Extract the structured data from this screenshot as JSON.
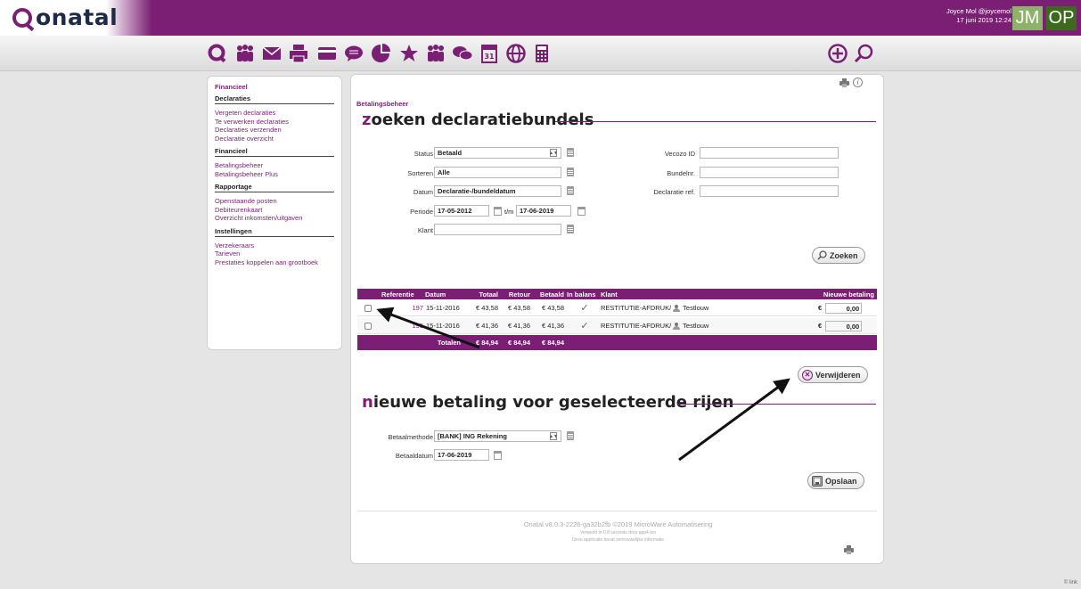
{
  "brand": {
    "name": "onatal"
  },
  "user": {
    "name": "Joyce Mol @joycemol",
    "datetime": "17 juni 2019 12:24",
    "avatar1": "JM",
    "avatar2": "OP"
  },
  "nav_icons": [
    "home-q-icon",
    "users-icon",
    "mail-icon",
    "printer-icon",
    "card-icon",
    "chat-bubble-icon",
    "pie-chart-icon",
    "star-icon",
    "group-icon",
    "comments-icon",
    "calendar-31-icon",
    "globe-icon",
    "calculator-icon",
    "add-circle-icon",
    "search-icon"
  ],
  "sidebar": {
    "title": "Financieel",
    "groups": [
      {
        "heading": "Declaraties",
        "links": [
          "Vergeten declaraties",
          "Te verwerken declaraties",
          "Declaraties verzenden",
          "Declaratie overzicht"
        ]
      },
      {
        "heading": "Financieel",
        "links": [
          "Betalingsbeheer",
          "Betalingsbeheer Plus"
        ]
      },
      {
        "heading": "Rapportage",
        "links": [
          "Openstaande posten",
          "Debiteurenkaart",
          "Overzicht inkomsten/uitgaven"
        ]
      },
      {
        "heading": "Instellingen",
        "links": [
          "Verzekeraars",
          "Tarieven",
          "Prestaties koppelen aan grootboek"
        ]
      }
    ]
  },
  "main": {
    "breadcrumb": "Betalingsbeheer",
    "search_title_first": "z",
    "search_title_rest": "oeken declaratiebundels",
    "form": {
      "status_label": "Status",
      "status_value": "Betaald",
      "sorteren_label": "Sorteren",
      "sorteren_value": "Alle",
      "datum_label": "Datum",
      "datum_value": "Declaratie-/bundeldatum",
      "periode_label": "Periode",
      "periode_from": "17-05-2012",
      "periode_sep": "t/m",
      "periode_to": "17-06-2019",
      "klant_label": "Klant",
      "klant_value": "",
      "vecozo_label": "Vecozo ID",
      "vecozo_value": "",
      "bundelnr_label": "Bundelnr.",
      "bundelnr_value": "",
      "declref_label": "Declaratie ref.",
      "declref_value": ""
    },
    "search_button": "Zoeken",
    "table": {
      "headers": {
        "ref": "Referentie",
        "datum": "Datum",
        "totaal": "Totaal",
        "retour": "Retour",
        "betaald": "Betaald",
        "balans": "In balans",
        "klant": "Klant",
        "nieuwe": "Nieuwe betaling"
      },
      "rows": [
        {
          "ref": "197",
          "datum": "15-11-2016",
          "totaal": "€ 43,58",
          "retour": "€ 43,58",
          "betaald": "€ 43,58",
          "balans": "✓",
          "klant_pre": "RESTITUTIE-AFDRUK/",
          "klant_post": "Testlouw",
          "currency": "€",
          "nieuwe": "0,00"
        },
        {
          "ref": "195",
          "datum": "15-11-2016",
          "totaal": "€ 41,36",
          "retour": "€ 41,36",
          "betaald": "€ 41,36",
          "balans": "✓",
          "klant_pre": "RESTITUTIE-AFDRUK/",
          "klant_post": "Testlouw",
          "currency": "€",
          "nieuwe": "0,00"
        }
      ],
      "totals": {
        "label": "Totalen",
        "totaal": "€ 84,94",
        "retour": "€ 84,94",
        "betaald": "€ 84,94"
      }
    },
    "delete_button": "Verwijderen",
    "payment_title_first": "n",
    "payment_title_rest": "ieuwe betaling voor geselecteerde rijen",
    "payment": {
      "methode_label": "Betaalmethode",
      "methode_value": "[BANK] ING Rekening",
      "datum_label": "Betaaldatum",
      "datum_value": "17-06-2019"
    },
    "save_button": "Opslaan",
    "footer": {
      "line1": "Onatal v8.0.3-2226-ga32b2fb ©2019 MicroWare Automatisering",
      "line2": "Verwerkt in 0.8 seconds door app4.ton",
      "line3": "Deze applicatie bevat vertrouwelijke informatie"
    }
  },
  "badge": "© link"
}
